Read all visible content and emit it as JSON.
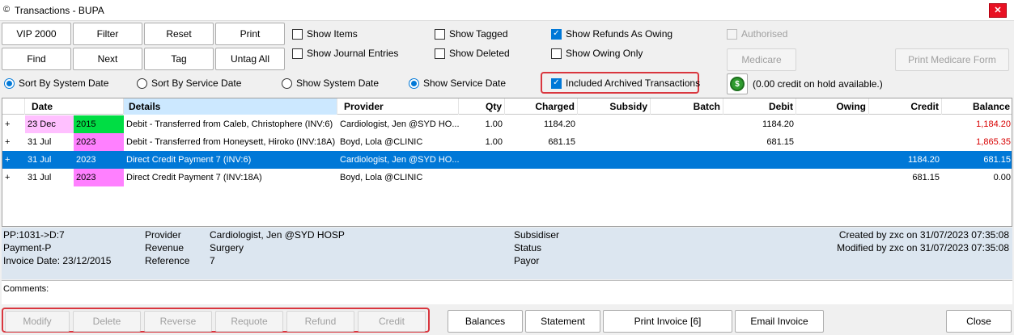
{
  "window": {
    "title": "Transactions - BUPA",
    "close_glyph": "✕"
  },
  "toolbar": {
    "vip": "VIP 2000",
    "filter": "Filter",
    "reset": "Reset",
    "print": "Print",
    "find": "Find",
    "next": "Next",
    "tag": "Tag",
    "untag_all": "Untag All"
  },
  "options": {
    "show_items": "Show Items",
    "show_journal": "Show Journal Entries",
    "show_tagged": "Show Tagged",
    "show_deleted": "Show Deleted",
    "show_refunds": "Show Refunds As Owing",
    "show_owing": "Show Owing Only",
    "authorised": "Authorised",
    "included_archived": "Included Archived Transactions"
  },
  "sort": {
    "by_system": "Sort By System Date",
    "by_service": "Sort By Service Date",
    "show_system": "Show System Date",
    "show_service": "Show Service Date"
  },
  "medicare": {
    "button": "Medicare",
    "print_form": "Print Medicare Form",
    "credit_hold": "(0.00 credit on hold available.)"
  },
  "grid": {
    "headers": [
      "Date",
      "Details",
      "Provider",
      "Qty",
      "Charged",
      "Subsidy",
      "Batch",
      "Debit",
      "Owing",
      "Credit",
      "Balance"
    ],
    "rows": [
      {
        "expand": "+",
        "date": "23 Dec",
        "year": "2015",
        "details": "Debit - Transferred from Caleb, Christophere (INV:6)",
        "provider": "Cardiologist, Jen @SYD HO...",
        "qty": "1.00",
        "charged": "1184.20",
        "debit": "1184.20",
        "credit": "",
        "balance": "1,184.20"
      },
      {
        "expand": "+",
        "date": "31 Jul",
        "year": "2023",
        "details": "Debit - Transferred from Honeysett, Hiroko (INV:18A)",
        "provider": "Boyd, Lola @CLINIC",
        "qty": "1.00",
        "charged": "681.15",
        "debit": "681.15",
        "credit": "",
        "balance": "1,865.35"
      },
      {
        "expand": "+",
        "date": "31 Jul",
        "year": "2023",
        "details": "Direct Credit Payment  7  (INV:6)",
        "provider": "Cardiologist, Jen @SYD HO...",
        "qty": "",
        "charged": "",
        "debit": "",
        "credit": "1184.20",
        "balance": "681.15"
      },
      {
        "expand": "+",
        "date": "31 Jul",
        "year": "2023",
        "details": "Direct Credit Payment  7  (INV:18A)",
        "provider": "Boyd, Lola @CLINIC",
        "qty": "",
        "charged": "",
        "debit": "",
        "credit": "681.15",
        "balance": "0.00"
      }
    ]
  },
  "details_panel": {
    "pp": "PP:1031->D:7",
    "payment": "Payment-P",
    "invoice_date": "Invoice Date: 23/12/2015",
    "provider_label": "Provider",
    "provider_value": "Cardiologist, Jen @SYD HOSP",
    "revenue_label": "Revenue",
    "revenue_value": "Surgery",
    "reference_label": "Reference",
    "reference_value": "7",
    "subsidiser_label": "Subsidiser",
    "status_label": "Status",
    "payor_label": "Payor",
    "created": "Created by zxc on 31/07/2023 07:35:08",
    "modified": "Modified by zxc on 31/07/2023 07:35:08"
  },
  "comments": {
    "label": "Comments:"
  },
  "bottom": {
    "modify": "Modify",
    "delete": "Delete",
    "reverse": "Reverse",
    "requote": "Requote",
    "refund": "Refund",
    "credit": "Credit",
    "balances": "Balances",
    "statement": "Statement",
    "print_invoice": "Print Invoice [6]",
    "email_invoice": "Email Invoice",
    "close": "Close"
  },
  "colors": {
    "selected_row": "#0078d7",
    "highlight_pink": "#ff80ff",
    "highlight_green": "#00dd44",
    "highlight_lightpink": "#ffc0ff",
    "annotation_red": "#d9363e"
  }
}
